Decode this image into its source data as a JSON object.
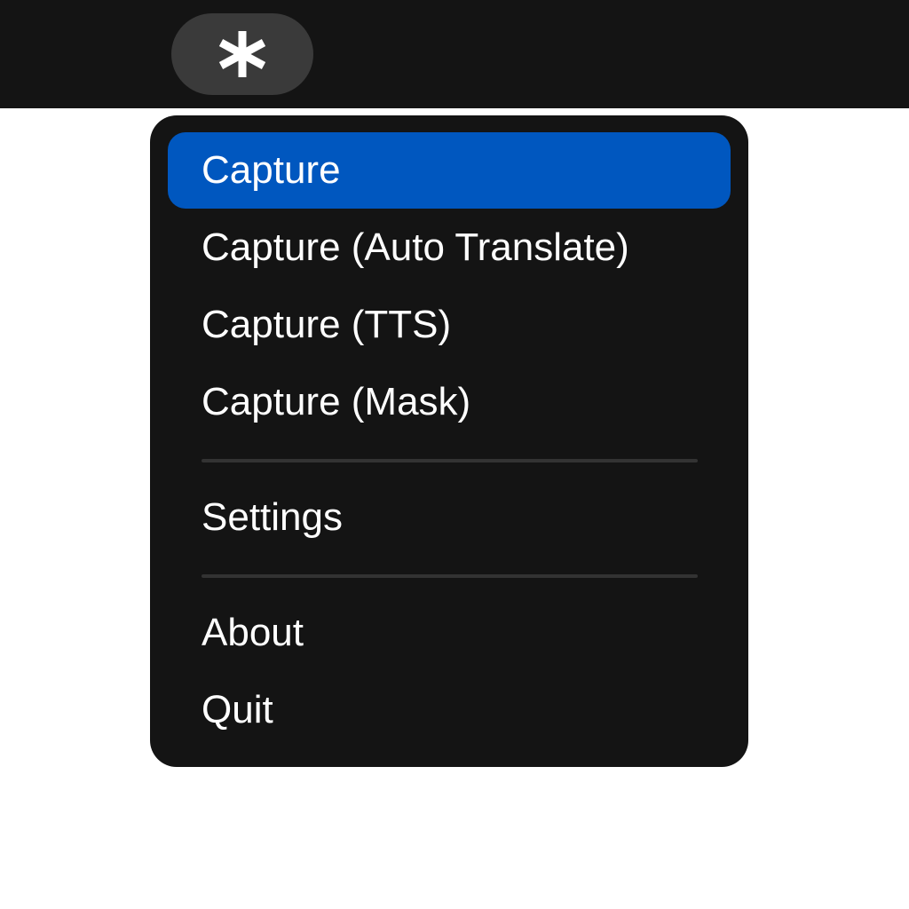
{
  "tray": {
    "icon": "asterisk-app-icon"
  },
  "menu": {
    "items": [
      {
        "label": "Capture",
        "selected": true
      },
      {
        "label": "Capture (Auto Translate)"
      },
      {
        "label": "Capture (TTS)"
      },
      {
        "label": "Capture (Mask)"
      },
      {
        "label": "Settings"
      },
      {
        "label": "About"
      },
      {
        "label": "Quit"
      }
    ],
    "highlight_color": "#0057bf"
  }
}
